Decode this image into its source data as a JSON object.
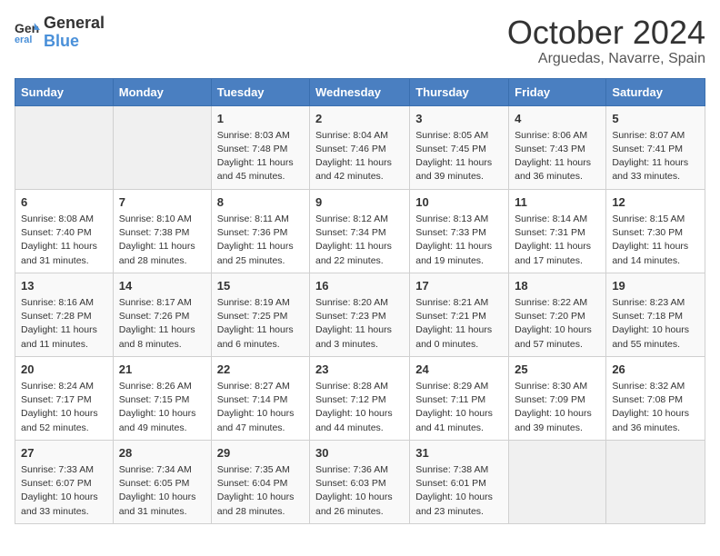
{
  "logo": {
    "line1": "General",
    "line2": "Blue"
  },
  "title": "October 2024",
  "location": "Arguedas, Navarre, Spain",
  "weekdays": [
    "Sunday",
    "Monday",
    "Tuesday",
    "Wednesday",
    "Thursday",
    "Friday",
    "Saturday"
  ],
  "weeks": [
    [
      {
        "day": "",
        "info": ""
      },
      {
        "day": "",
        "info": ""
      },
      {
        "day": "1",
        "info": "Sunrise: 8:03 AM\nSunset: 7:48 PM\nDaylight: 11 hours and 45 minutes."
      },
      {
        "day": "2",
        "info": "Sunrise: 8:04 AM\nSunset: 7:46 PM\nDaylight: 11 hours and 42 minutes."
      },
      {
        "day": "3",
        "info": "Sunrise: 8:05 AM\nSunset: 7:45 PM\nDaylight: 11 hours and 39 minutes."
      },
      {
        "day": "4",
        "info": "Sunrise: 8:06 AM\nSunset: 7:43 PM\nDaylight: 11 hours and 36 minutes."
      },
      {
        "day": "5",
        "info": "Sunrise: 8:07 AM\nSunset: 7:41 PM\nDaylight: 11 hours and 33 minutes."
      }
    ],
    [
      {
        "day": "6",
        "info": "Sunrise: 8:08 AM\nSunset: 7:40 PM\nDaylight: 11 hours and 31 minutes."
      },
      {
        "day": "7",
        "info": "Sunrise: 8:10 AM\nSunset: 7:38 PM\nDaylight: 11 hours and 28 minutes."
      },
      {
        "day": "8",
        "info": "Sunrise: 8:11 AM\nSunset: 7:36 PM\nDaylight: 11 hours and 25 minutes."
      },
      {
        "day": "9",
        "info": "Sunrise: 8:12 AM\nSunset: 7:34 PM\nDaylight: 11 hours and 22 minutes."
      },
      {
        "day": "10",
        "info": "Sunrise: 8:13 AM\nSunset: 7:33 PM\nDaylight: 11 hours and 19 minutes."
      },
      {
        "day": "11",
        "info": "Sunrise: 8:14 AM\nSunset: 7:31 PM\nDaylight: 11 hours and 17 minutes."
      },
      {
        "day": "12",
        "info": "Sunrise: 8:15 AM\nSunset: 7:30 PM\nDaylight: 11 hours and 14 minutes."
      }
    ],
    [
      {
        "day": "13",
        "info": "Sunrise: 8:16 AM\nSunset: 7:28 PM\nDaylight: 11 hours and 11 minutes."
      },
      {
        "day": "14",
        "info": "Sunrise: 8:17 AM\nSunset: 7:26 PM\nDaylight: 11 hours and 8 minutes."
      },
      {
        "day": "15",
        "info": "Sunrise: 8:19 AM\nSunset: 7:25 PM\nDaylight: 11 hours and 6 minutes."
      },
      {
        "day": "16",
        "info": "Sunrise: 8:20 AM\nSunset: 7:23 PM\nDaylight: 11 hours and 3 minutes."
      },
      {
        "day": "17",
        "info": "Sunrise: 8:21 AM\nSunset: 7:21 PM\nDaylight: 11 hours and 0 minutes."
      },
      {
        "day": "18",
        "info": "Sunrise: 8:22 AM\nSunset: 7:20 PM\nDaylight: 10 hours and 57 minutes."
      },
      {
        "day": "19",
        "info": "Sunrise: 8:23 AM\nSunset: 7:18 PM\nDaylight: 10 hours and 55 minutes."
      }
    ],
    [
      {
        "day": "20",
        "info": "Sunrise: 8:24 AM\nSunset: 7:17 PM\nDaylight: 10 hours and 52 minutes."
      },
      {
        "day": "21",
        "info": "Sunrise: 8:26 AM\nSunset: 7:15 PM\nDaylight: 10 hours and 49 minutes."
      },
      {
        "day": "22",
        "info": "Sunrise: 8:27 AM\nSunset: 7:14 PM\nDaylight: 10 hours and 47 minutes."
      },
      {
        "day": "23",
        "info": "Sunrise: 8:28 AM\nSunset: 7:12 PM\nDaylight: 10 hours and 44 minutes."
      },
      {
        "day": "24",
        "info": "Sunrise: 8:29 AM\nSunset: 7:11 PM\nDaylight: 10 hours and 41 minutes."
      },
      {
        "day": "25",
        "info": "Sunrise: 8:30 AM\nSunset: 7:09 PM\nDaylight: 10 hours and 39 minutes."
      },
      {
        "day": "26",
        "info": "Sunrise: 8:32 AM\nSunset: 7:08 PM\nDaylight: 10 hours and 36 minutes."
      }
    ],
    [
      {
        "day": "27",
        "info": "Sunrise: 7:33 AM\nSunset: 6:07 PM\nDaylight: 10 hours and 33 minutes."
      },
      {
        "day": "28",
        "info": "Sunrise: 7:34 AM\nSunset: 6:05 PM\nDaylight: 10 hours and 31 minutes."
      },
      {
        "day": "29",
        "info": "Sunrise: 7:35 AM\nSunset: 6:04 PM\nDaylight: 10 hours and 28 minutes."
      },
      {
        "day": "30",
        "info": "Sunrise: 7:36 AM\nSunset: 6:03 PM\nDaylight: 10 hours and 26 minutes."
      },
      {
        "day": "31",
        "info": "Sunrise: 7:38 AM\nSunset: 6:01 PM\nDaylight: 10 hours and 23 minutes."
      },
      {
        "day": "",
        "info": ""
      },
      {
        "day": "",
        "info": ""
      }
    ]
  ]
}
